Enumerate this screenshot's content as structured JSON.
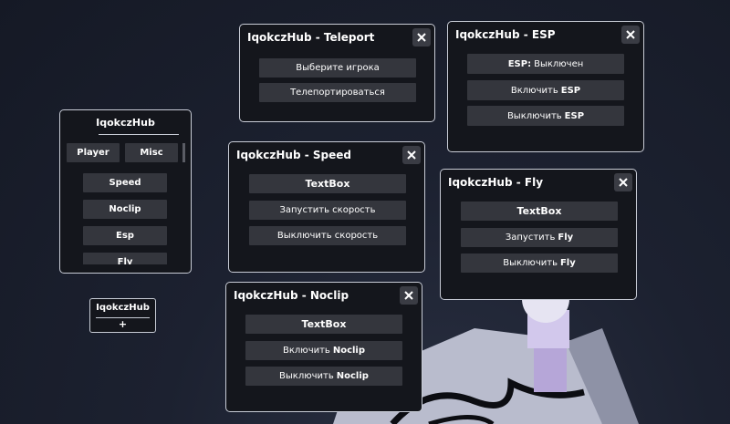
{
  "main_hub": {
    "title": "IqokczHub",
    "tabs": [
      "Player",
      "Misc"
    ],
    "items": [
      "Speed",
      "Noclip",
      "Esp",
      "Fly"
    ]
  },
  "mini_hub": {
    "title": "IqokczHub",
    "plus": "+"
  },
  "teleport": {
    "title": "IqokczHub - Teleport",
    "select_player": "Выберите игрока",
    "teleport_btn": "Телепортироваться"
  },
  "esp": {
    "title": "IqokczHub - ESP",
    "status_prefix": "ESP:",
    "status_value": "Выключен",
    "enable_prefix": "Включить",
    "enable_word": "ESP",
    "disable_prefix": "Выключить",
    "disable_word": "ESP"
  },
  "speed": {
    "title": "IqokczHub - Speed",
    "textbox": "TextBox",
    "start": "Запустить скорость",
    "stop": "Выключить скорость"
  },
  "fly": {
    "title": "IqokczHub - Fly",
    "textbox": "TextBox",
    "start_prefix": "Запустить",
    "start_word": "Fly",
    "stop_prefix": "Выключить",
    "stop_word": "Fly"
  },
  "noclip": {
    "title": "IqokczHub - Noclip",
    "textbox": "TextBox",
    "enable_prefix": "Включить",
    "enable_word": "Noclip",
    "disable_prefix": "Выключить",
    "disable_word": "Noclip"
  },
  "colors": {
    "panel_bg": "#14161c",
    "button_bg": "#34363d",
    "border": "#c8ccd6"
  },
  "icons": {
    "close": "close-icon"
  }
}
